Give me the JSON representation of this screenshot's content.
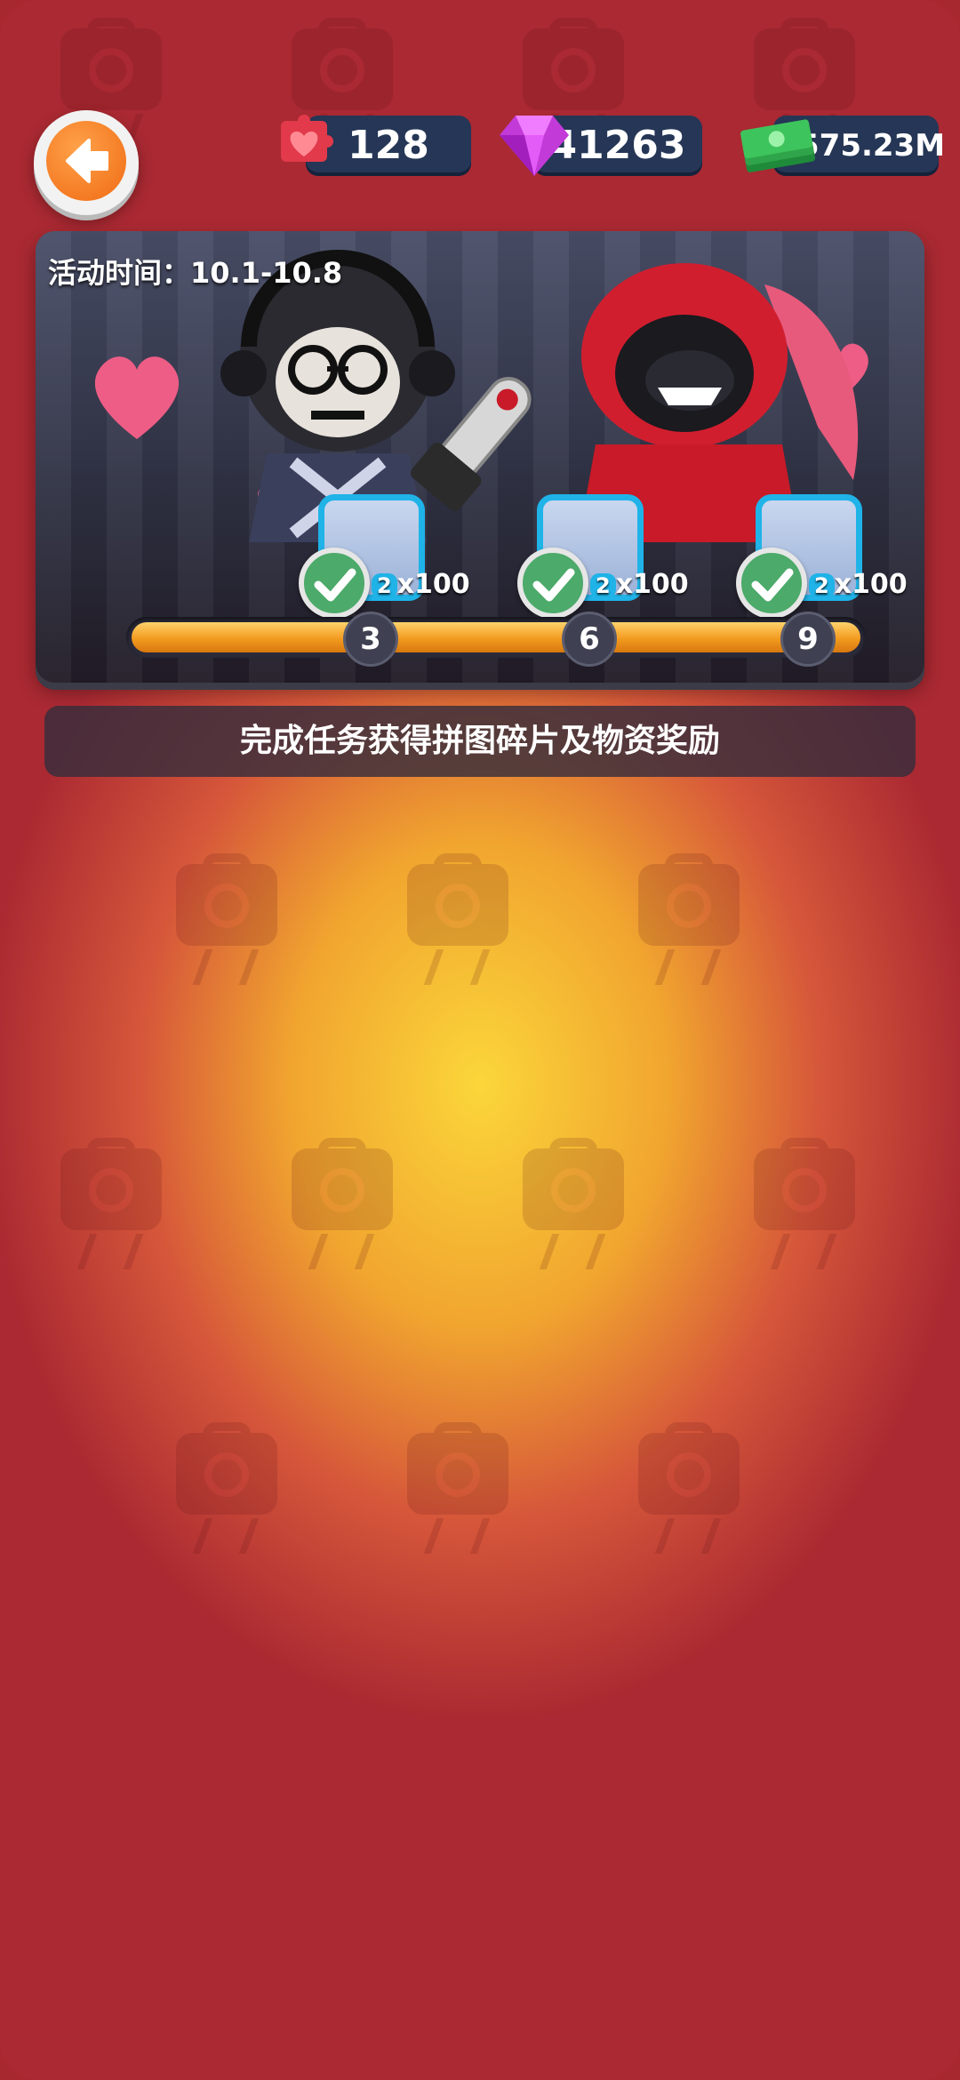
{
  "resources": {
    "hearts": "128",
    "gems": "41263",
    "cash": "575.23M"
  },
  "event": {
    "time_label": "活动时间：10.1-10.8",
    "rewards": [
      {
        "multiplier": "2",
        "quantity": "x100",
        "claimed": true
      },
      {
        "multiplier": "2",
        "quantity": "x100",
        "claimed": true
      },
      {
        "multiplier": "2",
        "quantity": "x100",
        "claimed": true
      }
    ],
    "milestones": [
      "3",
      "6",
      "9"
    ],
    "progress": 1.0
  },
  "task_banner": "完成任务获得拼图碎片及物资奖励",
  "colors": {
    "background_red": "#aa2932",
    "glow_yellow": "#fbd63a",
    "pill_navy": "#253656",
    "progress_orange": "#f29a1f",
    "reward_border": "#1fb3e8",
    "check_green": "#4caa6a",
    "back_orange": "#ef6a13"
  },
  "icons": {
    "back": "back-arrow-icon",
    "hearts": "heart-puzzle-icon",
    "gems": "gem-icon",
    "cash": "cash-stack-icon",
    "check": "check-icon"
  }
}
